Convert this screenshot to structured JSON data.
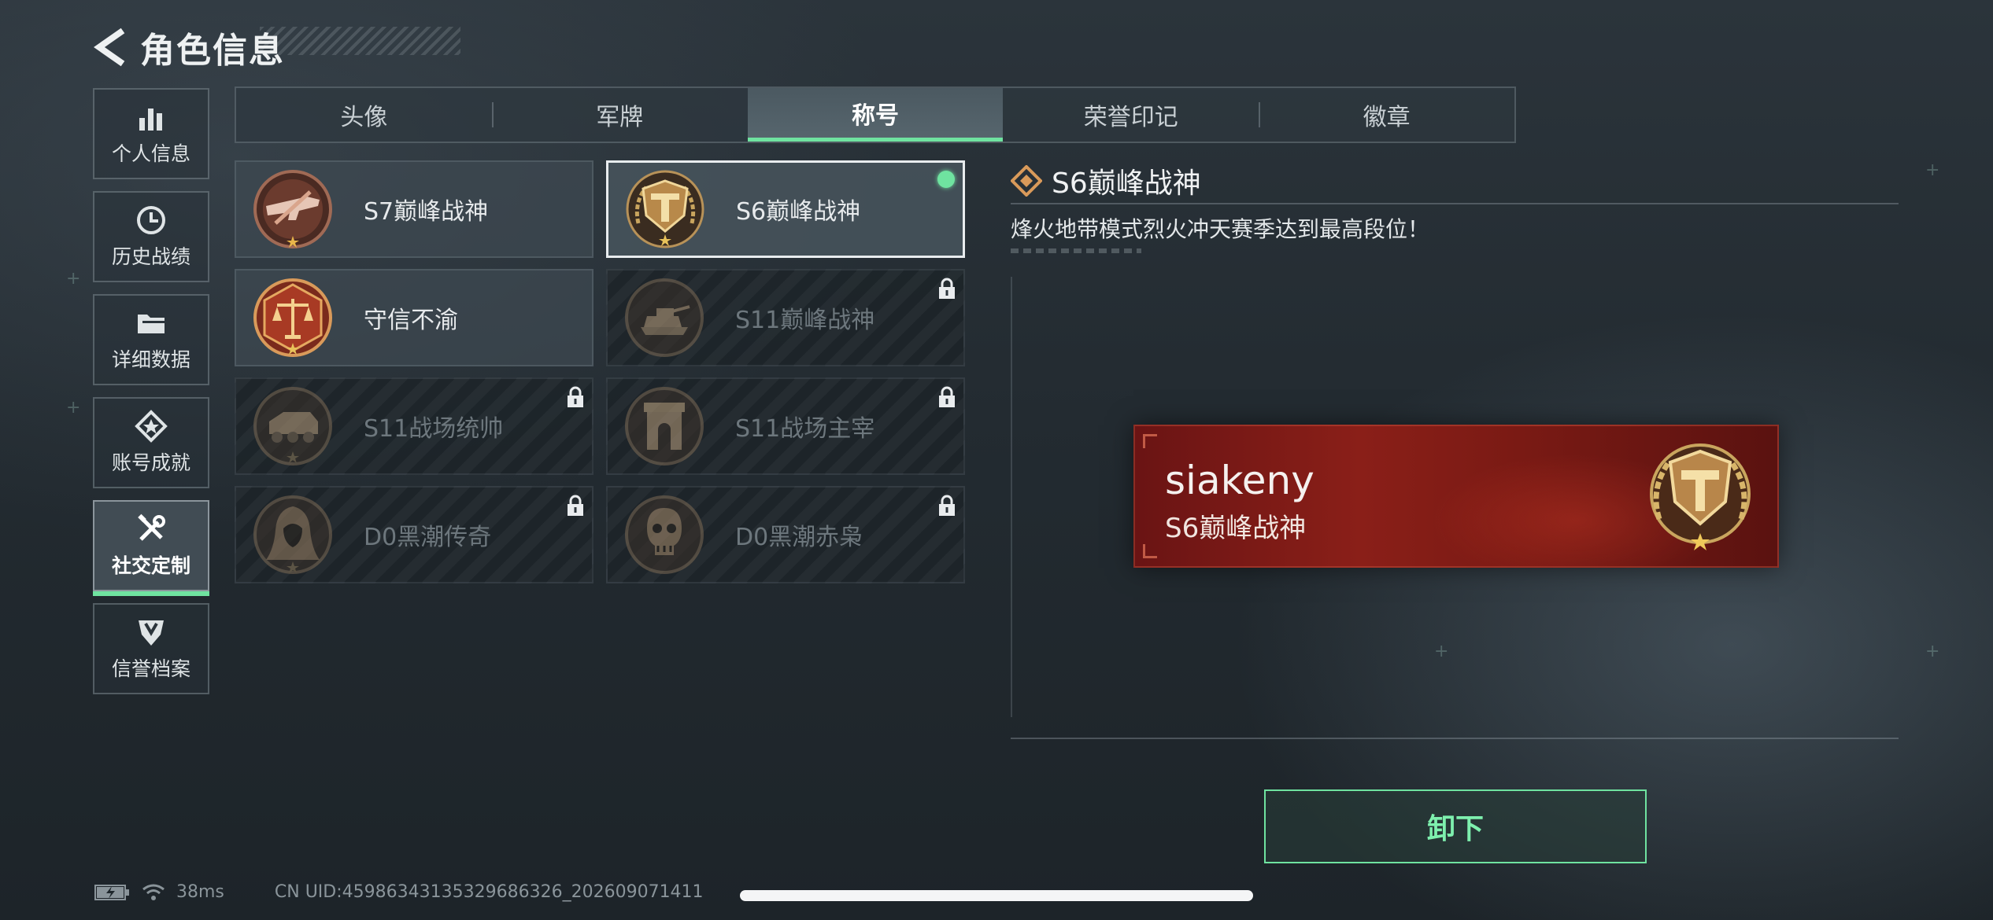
{
  "header": {
    "title": "角色信息"
  },
  "sidebar": {
    "items": [
      {
        "label": "个人信息",
        "icon": "bar-chart-icon",
        "active": false
      },
      {
        "label": "历史战绩",
        "icon": "clock-icon",
        "active": false
      },
      {
        "label": "详细数据",
        "icon": "folder-icon",
        "active": false
      },
      {
        "label": "账号成就",
        "icon": "star-badge-icon",
        "active": false
      },
      {
        "label": "社交定制",
        "icon": "tools-icon",
        "active": true
      },
      {
        "label": "信誉档案",
        "icon": "shield-emblem-icon",
        "active": false
      }
    ]
  },
  "tabs": [
    {
      "label": "头像",
      "active": false
    },
    {
      "label": "军牌",
      "active": false
    },
    {
      "label": "称号",
      "active": true
    },
    {
      "label": "荣誉印记",
      "active": false
    },
    {
      "label": "徽章",
      "active": false
    }
  ],
  "titles": [
    {
      "name": "S7巅峰战神",
      "emblem": "rifle-emblem",
      "locked": false,
      "selected": false,
      "equipped": false
    },
    {
      "name": "S6巅峰战神",
      "emblem": "t-shield-emblem",
      "locked": false,
      "selected": true,
      "equipped": true
    },
    {
      "name": "守信不渝",
      "emblem": "scales-emblem",
      "locked": false,
      "selected": false,
      "equipped": false
    },
    {
      "name": "S11巅峰战神",
      "emblem": "tank-emblem",
      "locked": true,
      "selected": false,
      "equipped": false
    },
    {
      "name": "S11战场统帅",
      "emblem": "apc-emblem",
      "locked": true,
      "selected": false,
      "equipped": false
    },
    {
      "name": "S11战场主宰",
      "emblem": "arch-emblem",
      "locked": true,
      "selected": false,
      "equipped": false
    },
    {
      "name": "D0黑潮传奇",
      "emblem": "hooded-figure-emblem",
      "locked": true,
      "selected": false,
      "equipped": false
    },
    {
      "name": "D0黑潮赤枭",
      "emblem": "skull-mask-emblem",
      "locked": true,
      "selected": false,
      "equipped": false
    }
  ],
  "detail": {
    "title": "S6巅峰战神",
    "description": "烽火地带模式烈火冲天赛季达到最高段位！",
    "preview": {
      "player_name": "siakeny",
      "title": "S6巅峰战神"
    }
  },
  "actions": {
    "unequip_label": "卸下"
  },
  "status_bar": {
    "ping": "38ms",
    "uid": "CN UID:45986343135329686326_202609071411"
  },
  "colors": {
    "accent_green": "#6fe3a0",
    "banner_red": "#8a1f18",
    "background": "#232b31"
  }
}
